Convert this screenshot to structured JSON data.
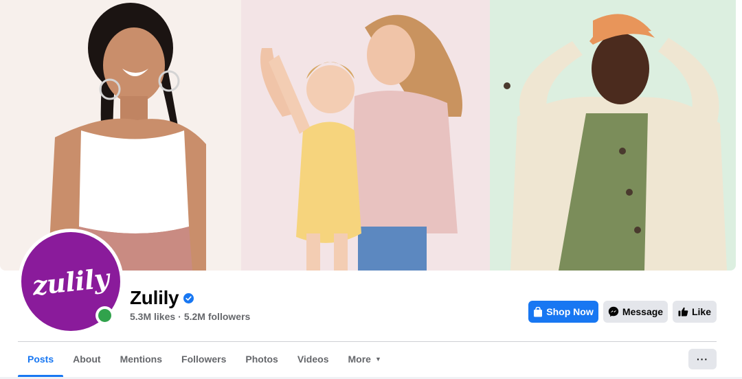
{
  "cover": {
    "panels": [
      {
        "name": "woman-white-tank",
        "bg": "#f7f0ec"
      },
      {
        "name": "mother-with-toddler",
        "bg": "#f3e4e6"
      },
      {
        "name": "boy-orange-cap",
        "bg": "#dcefe0"
      }
    ]
  },
  "profile": {
    "logo_text": "zulily",
    "logo_color": "#8a1b9b",
    "name": "Zulily",
    "verified": true,
    "likes": "5.3M likes",
    "separator": "·",
    "followers": "5.2M followers",
    "online": true
  },
  "actions": {
    "shop_label": "Shop Now",
    "message_label": "Message",
    "like_label": "Like",
    "primary_color": "#1877f2"
  },
  "tabs": [
    {
      "label": "Posts",
      "active": true
    },
    {
      "label": "About",
      "active": false
    },
    {
      "label": "Mentions",
      "active": false
    },
    {
      "label": "Followers",
      "active": false
    },
    {
      "label": "Photos",
      "active": false
    },
    {
      "label": "Videos",
      "active": false
    },
    {
      "label": "More",
      "active": false,
      "has_dropdown": true
    }
  ],
  "more_menu_label": "···"
}
